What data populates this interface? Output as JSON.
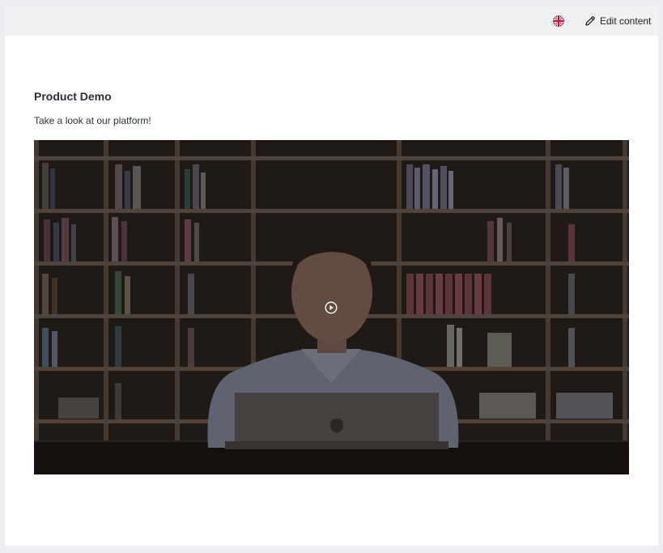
{
  "topbar": {
    "language_icon": "uk-flag-icon",
    "edit_label": "Edit content",
    "edit_icon": "pencil-icon"
  },
  "content": {
    "title": "Product Demo",
    "subtitle": "Take a look at our platform!"
  },
  "video": {
    "play_icon": "play-circle-icon",
    "scene_icon": "presenter-at-bookshelf-thumbnail"
  },
  "colors": {
    "background": "#eceef1",
    "topbar": "#f0f1f3",
    "text": "#2a2f3a"
  }
}
